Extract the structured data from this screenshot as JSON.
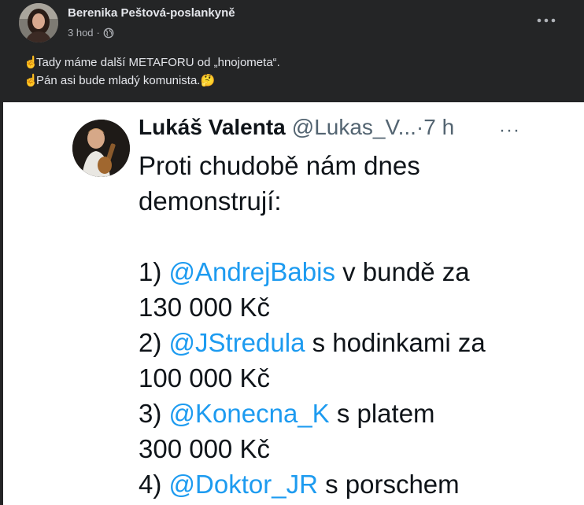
{
  "post": {
    "author": "Berenika Peštová-poslankyně",
    "time": "3 hod",
    "separator": "·",
    "more_icon": "more-horizontal-icon",
    "lines": [
      {
        "emoji": "☝",
        "text": "Tady máme další METAFORU od „hnojometa“."
      },
      {
        "emoji": "☝",
        "text": "Pán asi bude mladý komunista."
      }
    ],
    "thinking_emoji": "🤔"
  },
  "tweet": {
    "name": "Lukáš Valenta",
    "handle": "@Lukas_V...",
    "separator": "·",
    "time": "7 h",
    "more": "···",
    "intro_line1": "Proti chudobě nám dnes",
    "intro_line2": "demonstrují:",
    "items": [
      {
        "num": "1)",
        "mention": "@AndrejBabis",
        "rest": " v bundě za",
        "value": "130 000 Kč"
      },
      {
        "num": "2)",
        "mention": "@JStredula",
        "rest": " s hodinkami za",
        "value": "100 000 Kč"
      },
      {
        "num": "3)",
        "mention": "@Konecna_K",
        "rest": " s platem",
        "value": "300 000 Kč"
      },
      {
        "num": "4)",
        "mention": "@Doktor_JR",
        "rest": " s porschem"
      }
    ]
  },
  "colors": {
    "fb_bg": "#242526",
    "fb_text": "#e4e6eb",
    "fb_secondary": "#b0b3b8",
    "tweet_bg": "#ffffff",
    "tweet_text": "#0f1419",
    "tweet_mention": "#1d9bf0",
    "tweet_secondary": "#536471"
  }
}
